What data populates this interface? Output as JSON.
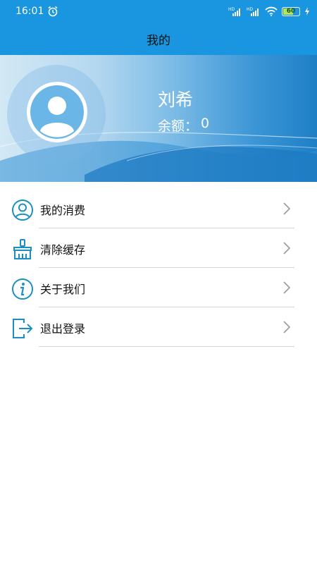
{
  "status_bar": {
    "time": "16:01",
    "alarm_icon": "alarm-clock-icon",
    "signal_icons": [
      "signal-hd-1-icon",
      "signal-hd-2-icon"
    ],
    "wifi_icon": "wifi-icon",
    "battery_level": "60",
    "charging_icon": "bolt-icon"
  },
  "header": {
    "title": "我的"
  },
  "profile": {
    "name": "刘希",
    "balance_label": "余额：",
    "balance_value": "0",
    "avatar_icon": "user-avatar-icon"
  },
  "menu": {
    "items": [
      {
        "label": "我的消费",
        "icon": "user-circle-icon"
      },
      {
        "label": "清除缓存",
        "icon": "broom-icon"
      },
      {
        "label": "关于我们",
        "icon": "info-icon"
      },
      {
        "label": "退出登录",
        "icon": "logout-icon"
      }
    ]
  },
  "colors": {
    "primary": "#1a96e0",
    "icon": "#1a8fc6",
    "divider": "#d6d6d6",
    "chevron": "#9a9a9a"
  }
}
